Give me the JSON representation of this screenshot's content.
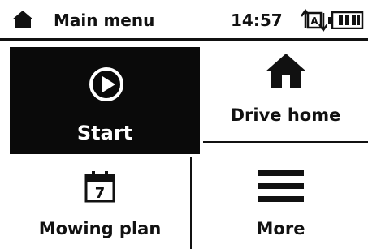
{
  "header": {
    "title": "Main menu",
    "time": "14:57",
    "icons": [
      "home-icon",
      "auto-mode-icon",
      "battery-icon"
    ]
  },
  "tiles": [
    {
      "label": "Start",
      "icon": "play-icon",
      "selected": true
    },
    {
      "label": "Drive home",
      "icon": "house-icon"
    },
    {
      "label": "Mowing plan",
      "icon": "calendar-icon",
      "icon_text": "7"
    },
    {
      "label": "More",
      "icon": "menu-icon"
    }
  ],
  "auto_icon_text": "A",
  "colors": {
    "background": "#ffffff",
    "foreground": "#111111",
    "selected": "#0a0a0a"
  },
  "battery_level": 0.8
}
